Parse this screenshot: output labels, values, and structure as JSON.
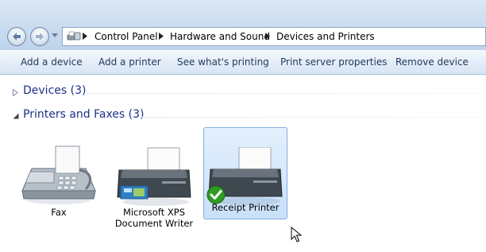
{
  "breadcrumb": [
    "Control Panel",
    "Hardware and Sound",
    "Devices and Printers"
  ],
  "toolbar": {
    "add_device": "Add a device",
    "add_printer": "Add a printer",
    "see_printing": "See what's printing",
    "server_properties": "Print server properties",
    "remove_device": "Remove device"
  },
  "groups": {
    "devices": "Devices (3)",
    "printers": "Printers and Faxes (3)"
  },
  "printers": [
    {
      "line1": "Fax",
      "line2": ""
    },
    {
      "line1": "Microsoft XPS",
      "line2": "Document Writer"
    },
    {
      "line1": "Receipt Printer",
      "line2": ""
    }
  ],
  "colors": {
    "accent_text": "#1e3287",
    "selection": "#c8e0fa",
    "default_check": "#2e9b22"
  }
}
